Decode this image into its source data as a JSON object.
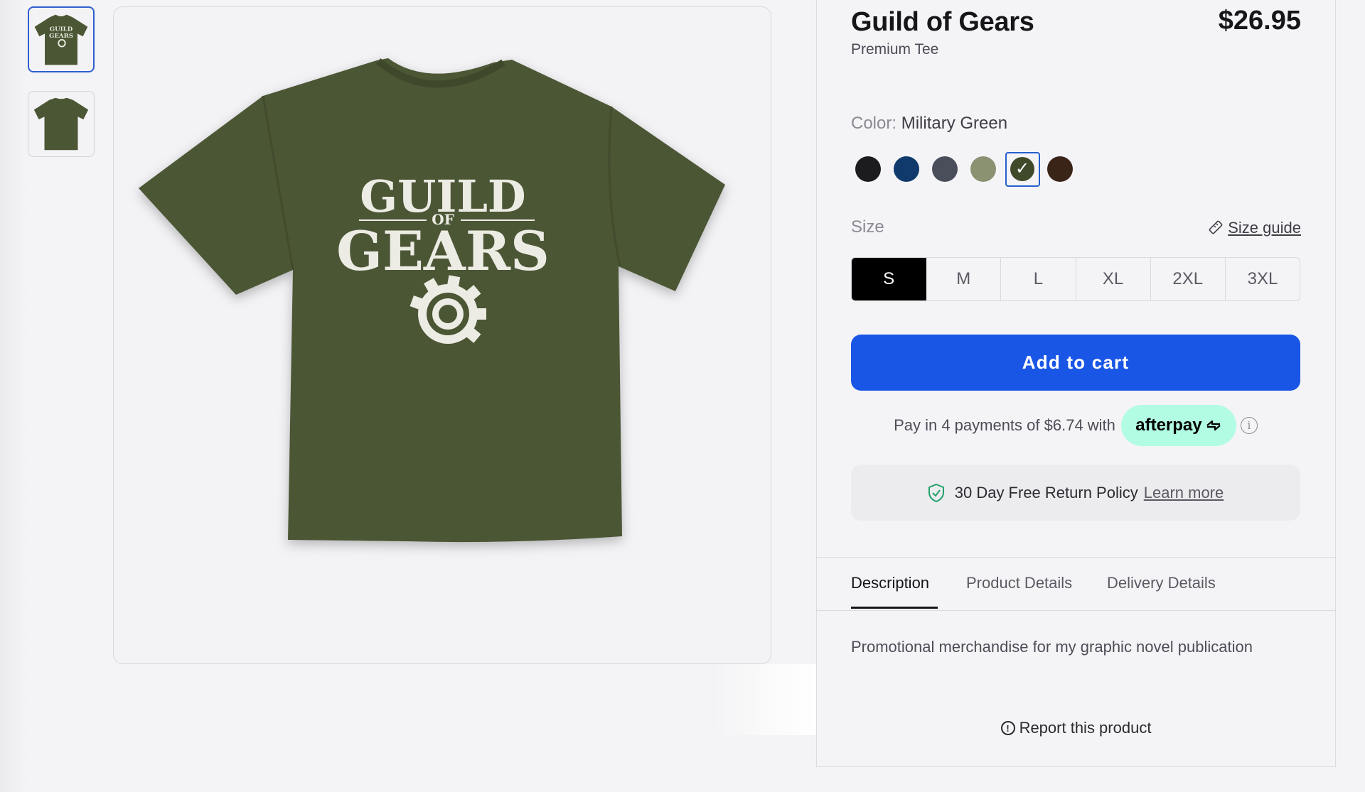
{
  "product": {
    "title": "Guild of Gears",
    "subtitle": "Premium Tee",
    "price": "$26.95",
    "print_line1": "GUILD",
    "print_of": "OF",
    "print_line2": "GEARS",
    "shirt_color": "#4b5634"
  },
  "thumbnails": [
    {
      "name": "front-view",
      "selected": true
    },
    {
      "name": "back-view",
      "selected": false
    }
  ],
  "color": {
    "label": "Color:",
    "selected_name": "Military Green",
    "swatches": [
      {
        "hex": "#1c1c1e"
      },
      {
        "hex": "#0f3a6b"
      },
      {
        "hex": "#4a4e5a"
      },
      {
        "hex": "#8a9272"
      },
      {
        "hex": "#404a2a",
        "selected": true,
        "check": "✓"
      },
      {
        "hex": "#3a2418"
      }
    ]
  },
  "size": {
    "label": "Size",
    "guide_label": "Size guide",
    "options": [
      "S",
      "M",
      "L",
      "XL",
      "2XL",
      "3XL"
    ],
    "selected": "S"
  },
  "cart": {
    "label": "Add to cart"
  },
  "afterpay": {
    "text": "Pay in 4 payments of $6.74 with",
    "brand": "afterpay",
    "info": "i",
    "brand_color": "#b2fce4"
  },
  "returns": {
    "text": "30 Day Free Return Policy",
    "link": "Learn more"
  },
  "tabs": [
    {
      "label": "Description",
      "active": true
    },
    {
      "label": "Product Details"
    },
    {
      "label": "Delivery Details"
    }
  ],
  "description": "Promotional merchandise for my graphic novel publication",
  "report": {
    "label": "Report this product",
    "icon": "!"
  },
  "accent": "#1a56e6"
}
